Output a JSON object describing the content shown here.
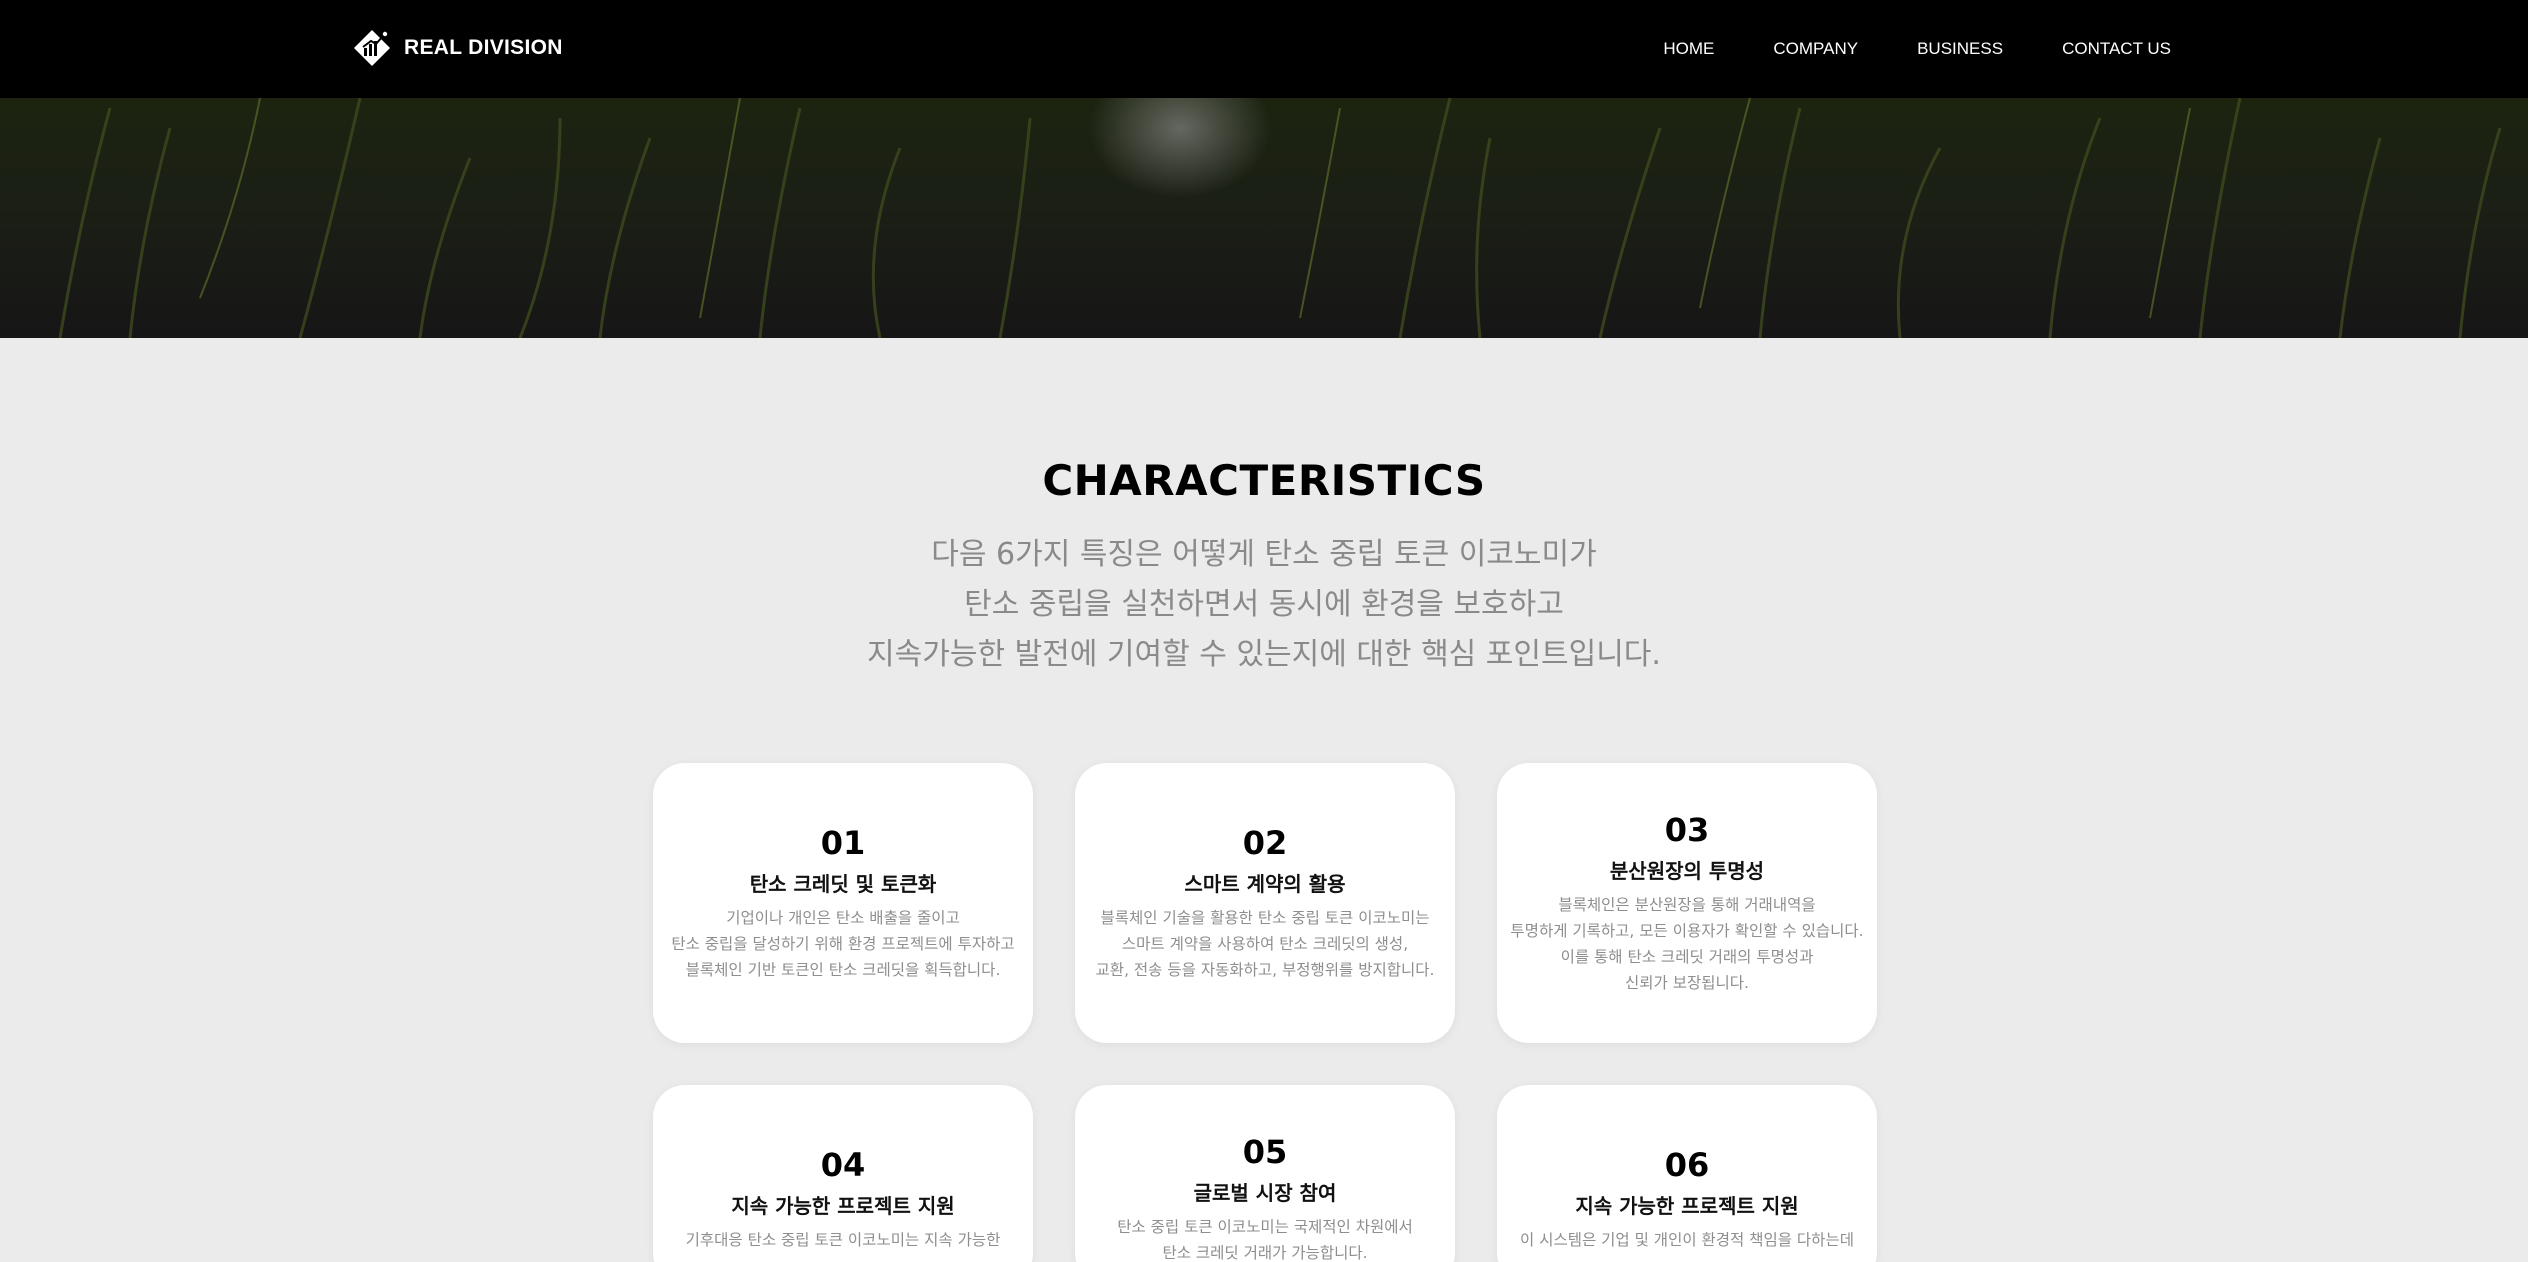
{
  "header": {
    "brand": "REAL DIVISION",
    "nav": [
      "HOME",
      "COMPANY",
      "BUSINESS",
      "CONTACT US"
    ]
  },
  "section": {
    "title": "CHARACTERISTICS",
    "subtitle_lines": [
      "다음 6가지 특징은 어떻게 탄소 중립 토큰 이코노미가",
      "탄소 중립을 실천하면서 동시에 환경을 보호하고",
      "지속가능한 발전에 기여할 수 있는지에 대한 핵심 포인트입니다."
    ]
  },
  "cards": [
    {
      "num": "01",
      "title": "탄소 크레딧 및 토큰화",
      "desc": [
        "기업이나 개인은 탄소 배출을 줄이고",
        "탄소 중립을 달성하기 위해 환경 프로젝트에 투자하고",
        "블록체인 기반 토큰인 탄소 크레딧을 획득합니다."
      ]
    },
    {
      "num": "02",
      "title": "스마트 계약의 활용",
      "desc": [
        "블록체인 기술을 활용한 탄소 중립 토큰 이코노미는",
        "스마트 계약을 사용하여 탄소 크레딧의 생성,",
        "교환, 전송 등을 자동화하고, 부정행위를 방지합니다."
      ]
    },
    {
      "num": "03",
      "title": "분산원장의 투명성",
      "desc": [
        "블록체인은 분산원장을 통해 거래내역을",
        "투명하게 기록하고, 모든 이용자가 확인할 수 있습니다.",
        "이를 통해 탄소 크레딧 거래의 투명성과",
        "신뢰가 보장됩니다."
      ]
    },
    {
      "num": "04",
      "title": "지속 가능한 프로젝트 지원",
      "desc": [
        "기후대응 탄소 중립 토큰 이코노미는 지속 가능한"
      ]
    },
    {
      "num": "05",
      "title": "글로벌 시장 참여",
      "desc": [
        "탄소 중립 토큰 이코노미는 국제적인 차원에서",
        "탄소 크레딧 거래가 가능합니다."
      ]
    },
    {
      "num": "06",
      "title": "지속 가능한 프로젝트 지원",
      "desc": [
        "이 시스템은 기업 및 개인이 환경적 책임을 다하는데"
      ]
    }
  ]
}
